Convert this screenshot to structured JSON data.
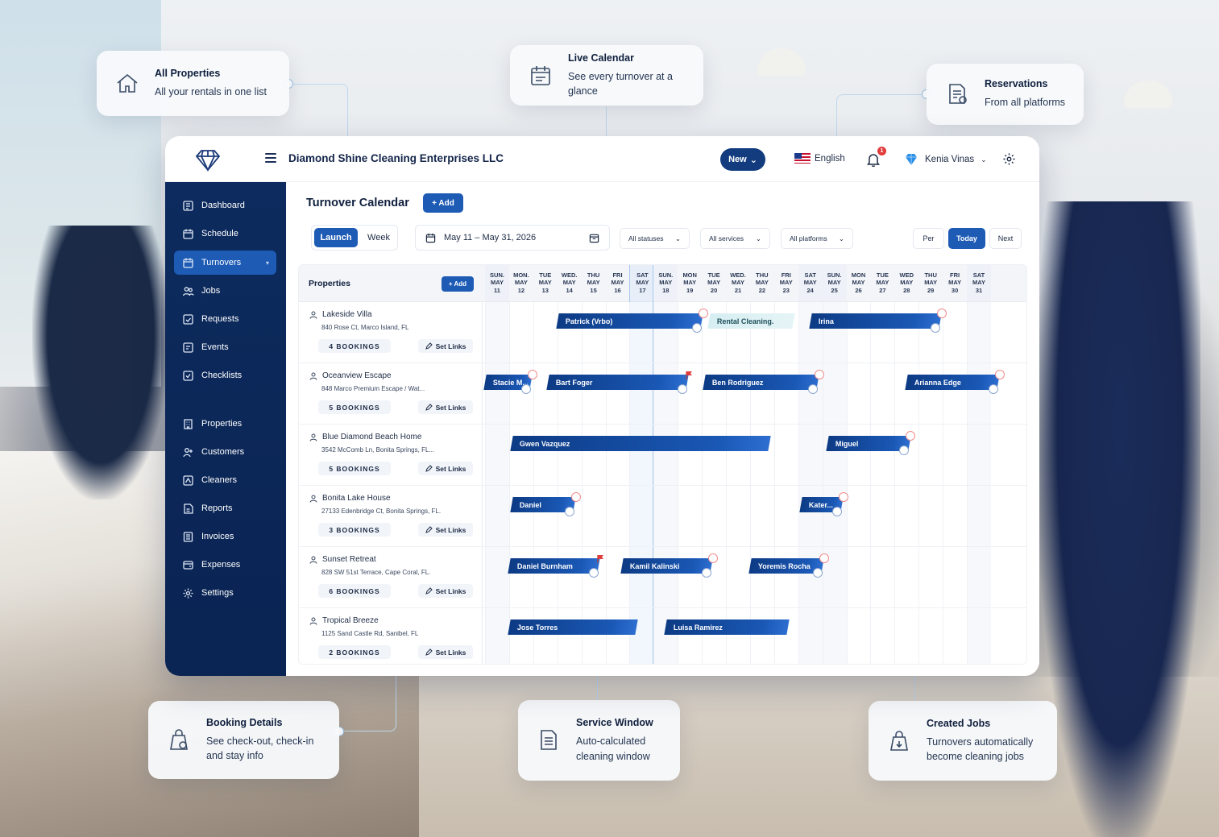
{
  "callouts": {
    "all_properties": {
      "title": "All Properties",
      "subtitle": "All your rentals in one list",
      "icon": "home-icon"
    },
    "live_calendar": {
      "title": "Live Calendar",
      "subtitle": "See every turnover at a glance",
      "icon": "calendar-icon"
    },
    "reservations": {
      "title": "Reservations",
      "subtitle": "From all platforms",
      "icon": "document-icon"
    },
    "booking_details": {
      "title": "Booking Details",
      "subtitle_1": "See check-out, check-in",
      "subtitle_2": "and stay info",
      "icon": "cleaning-bag-icon"
    },
    "service_window": {
      "title": "Service Window",
      "subtitle_1": "Auto-calculated",
      "subtitle_2": "cleaning window",
      "icon": "document-icon"
    },
    "created_jobs": {
      "title": "Created Jobs",
      "subtitle_1": "Turnovers automatically",
      "subtitle_2": "become cleaning jobs",
      "icon": "bag-icon"
    }
  },
  "header": {
    "company": "Diamond Shine Cleaning Enterprises LLC",
    "new_label": "New",
    "language": "English",
    "notifications": "1",
    "user": "Kenia Vinas"
  },
  "sidebar": {
    "items": [
      {
        "label": "Dashboard",
        "icon": "dashboard-icon"
      },
      {
        "label": "Schedule",
        "icon": "calendar-icon"
      },
      {
        "label": "Turnovers",
        "icon": "calendar-icon",
        "active": true
      },
      {
        "label": "Jobs",
        "icon": "users-icon"
      },
      {
        "label": "Requests",
        "icon": "request-icon"
      },
      {
        "label": "Events",
        "icon": "events-icon"
      },
      {
        "label": "Checklists",
        "icon": "checklist-icon"
      },
      {
        "label": "Properties",
        "icon": "building-icon"
      },
      {
        "label": "Customers",
        "icon": "customers-icon"
      },
      {
        "label": "Cleaners",
        "icon": "cleaners-icon"
      },
      {
        "label": "Reports",
        "icon": "reports-icon"
      },
      {
        "label": "Invoices",
        "icon": "invoices-icon"
      },
      {
        "label": "Expenses",
        "icon": "expenses-icon"
      },
      {
        "label": "Settings",
        "icon": "gear-icon"
      }
    ]
  },
  "main": {
    "title": "Turnover Calendar",
    "add_label": "+ Add",
    "view_launch": "Launch",
    "view_week": "Week",
    "date_range": "May 11 – May 31, 2026",
    "filter_status": "All statuses",
    "filter_services": "All services",
    "filter_platforms": "All platforms",
    "prev_label": "Per",
    "today_label": "Today",
    "next_label": "Next",
    "grid_title": "Properties",
    "grid_add": "+ Add",
    "set_links": "Set Links",
    "days": [
      {
        "dow": "SUN.",
        "mon": "MAY",
        "d": "11"
      },
      {
        "dow": "MON.",
        "mon": "MAY",
        "d": "12"
      },
      {
        "dow": "TUE",
        "mon": "MAY",
        "d": "13"
      },
      {
        "dow": "WED.",
        "mon": "MAY",
        "d": "14"
      },
      {
        "dow": "THU",
        "mon": "MAY",
        "d": "15"
      },
      {
        "dow": "FRI",
        "mon": "MAY",
        "d": "16"
      },
      {
        "dow": "SAT",
        "mon": "MAY",
        "d": "17"
      },
      {
        "dow": "SUN.",
        "mon": "MAY",
        "d": "18"
      },
      {
        "dow": "MON",
        "mon": "MAY",
        "d": "19"
      },
      {
        "dow": "TUE",
        "mon": "MAY",
        "d": "20"
      },
      {
        "dow": "WED.",
        "mon": "MAY",
        "d": "21"
      },
      {
        "dow": "THU",
        "mon": "MAY",
        "d": "22"
      },
      {
        "dow": "FRI",
        "mon": "MAY",
        "d": "23"
      },
      {
        "dow": "SAT",
        "mon": "MAY",
        "d": "24"
      },
      {
        "dow": "SUN.",
        "mon": "MAY",
        "d": "25"
      },
      {
        "dow": "MON",
        "mon": "MAY",
        "d": "26"
      },
      {
        "dow": "TUE",
        "mon": "MAY",
        "d": "27"
      },
      {
        "dow": "WED",
        "mon": "MAY",
        "d": "28"
      },
      {
        "dow": "THU",
        "mon": "MAY",
        "d": "29"
      },
      {
        "dow": "FRI",
        "mon": "MAY",
        "d": "30"
      },
      {
        "dow": "SAT",
        "mon": "MAY",
        "d": "31"
      }
    ],
    "properties": [
      {
        "name": "Lakeside Villa",
        "address": "840 Rose Ct, Marco Island, FL",
        "bookings": "4 BOOKINGS"
      },
      {
        "name": "Oceanview Escape",
        "address": "848 Marco Premium Escape / Wat...",
        "bookings": "5 BOOKINGS"
      },
      {
        "name": "Blue Diamond Beach Home",
        "address": "3542 McComb Ln, Bonita Springs, FL...",
        "bookings": "5 BOOKINGS"
      },
      {
        "name": "Bonita Lake House",
        "address": "27133 Edenbridge Ct, Bonita Springs, FL.",
        "bookings": "3 BOOKINGS"
      },
      {
        "name": "Sunset Retreat",
        "address": "828 SW 51st Terrace, Cape Coral, FL.",
        "bookings": "6 BOOKINGS"
      },
      {
        "name": "Tropical Breeze",
        "address": "1125 Sand Castle Rd, Sanibel, FL",
        "bookings": "2 BOOKINGS"
      }
    ],
    "bookings": [
      {
        "row": 0,
        "guest": "Patrick (Vrbo)",
        "start": 3,
        "end": 9,
        "flag": "outline"
      },
      {
        "row": 0,
        "guest": "Rental Cleaning.",
        "start": 9.3,
        "end": 12.8,
        "style": "light"
      },
      {
        "row": 0,
        "guest": "Irina",
        "start": 13.5,
        "end": 18.9,
        "flag": "outline"
      },
      {
        "row": 1,
        "guest": "Stacie M...",
        "start": 0,
        "end": 1.9,
        "flag": "outline"
      },
      {
        "row": 1,
        "guest": "Bart Foger",
        "start": 2.6,
        "end": 8.4,
        "flag": "solid"
      },
      {
        "row": 1,
        "guest": "Ben Rodriguez",
        "start": 9.1,
        "end": 13.8,
        "flag": "outline"
      },
      {
        "row": 1,
        "guest": "Arianna Edge",
        "start": 17.5,
        "end": 21.3,
        "flag": "outline"
      },
      {
        "row": 2,
        "guest": "Gwen Vazquez",
        "start": 1.1,
        "end": 11.8
      },
      {
        "row": 2,
        "guest": "Miguel",
        "start": 14.2,
        "end": 17.6,
        "flag": "outline"
      },
      {
        "row": 3,
        "guest": "Daniel",
        "start": 1.1,
        "end": 3.7,
        "flag": "outline"
      },
      {
        "row": 3,
        "guest": "Kater...",
        "start": 13.1,
        "end": 14.8,
        "flag": "outline"
      },
      {
        "row": 4,
        "guest": "Daniel Burnham",
        "start": 1,
        "end": 4.7,
        "flag": "solid"
      },
      {
        "row": 4,
        "guest": "Kamil Kalinski",
        "start": 5.7,
        "end": 9.4,
        "flag": "outline"
      },
      {
        "row": 4,
        "guest": "Yoremis Rocha",
        "start": 11,
        "end": 14,
        "flag": "outline"
      },
      {
        "row": 5,
        "guest": "Jose Torres",
        "start": 1,
        "end": 6.3
      },
      {
        "row": 5,
        "guest": "Luisa Ramirez",
        "start": 7.5,
        "end": 12.6
      }
    ]
  }
}
